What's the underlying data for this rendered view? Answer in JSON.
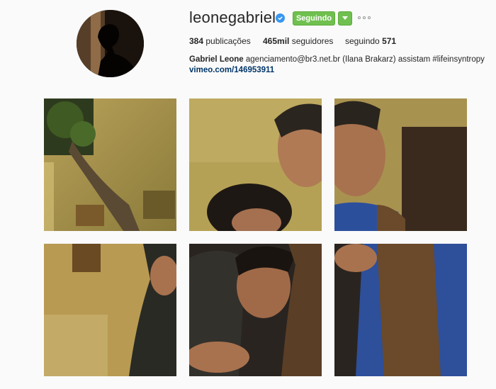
{
  "profile": {
    "username": "leonegabriel",
    "verified": true,
    "follow_label": "Seguindo",
    "posts_count": "384",
    "posts_label": "publicações",
    "followers_count": "465mil",
    "followers_label": "seguidores",
    "following_label": "seguindo",
    "following_count": "571",
    "bio_name": "Gabriel Leone",
    "bio_text": "agenciamento@br3.net.br (Ilana Brakarz) assistam #lifeinsyntropy",
    "bio_link": "vimeo.com/146953911"
  },
  "colors": {
    "follow_green": "#70c050",
    "verified_blue": "#3897f0",
    "link_blue": "#003569"
  },
  "icons": [
    "verified-icon",
    "chevron-down-icon",
    "more-options-icon"
  ]
}
